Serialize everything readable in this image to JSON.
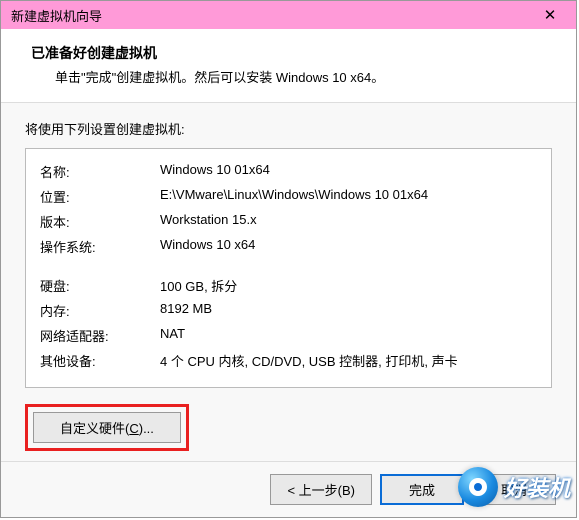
{
  "titlebar": {
    "title": "新建虚拟机向导",
    "close": "✕"
  },
  "header": {
    "title": "已准备好创建虚拟机",
    "subtitle": "单击\"完成\"创建虚拟机。然后可以安装 Windows 10 x64。"
  },
  "intro": "将使用下列设置创建虚拟机:",
  "settings": {
    "name_label": "名称:",
    "name_value": "Windows 10 01x64",
    "location_label": "位置:",
    "location_value": "E:\\VMware\\Linux\\Windows\\Windows 10 01x64",
    "version_label": "版本:",
    "version_value": "Workstation 15.x",
    "os_label": "操作系统:",
    "os_value": "Windows 10 x64",
    "disk_label": "硬盘:",
    "disk_value": "100 GB, 拆分",
    "memory_label": "内存:",
    "memory_value": "8192 MB",
    "network_label": "网络适配器:",
    "network_value": "NAT",
    "other_label": "其他设备:",
    "other_value": "4 个 CPU 内核, CD/DVD, USB 控制器, 打印机, 声卡"
  },
  "buttons": {
    "customize_prefix": "自定义硬件(",
    "customize_key": "C",
    "customize_suffix": ")...",
    "back": "< 上一步(B)",
    "finish": "完成",
    "cancel": "取消"
  },
  "watermark": {
    "text": "好装机"
  }
}
